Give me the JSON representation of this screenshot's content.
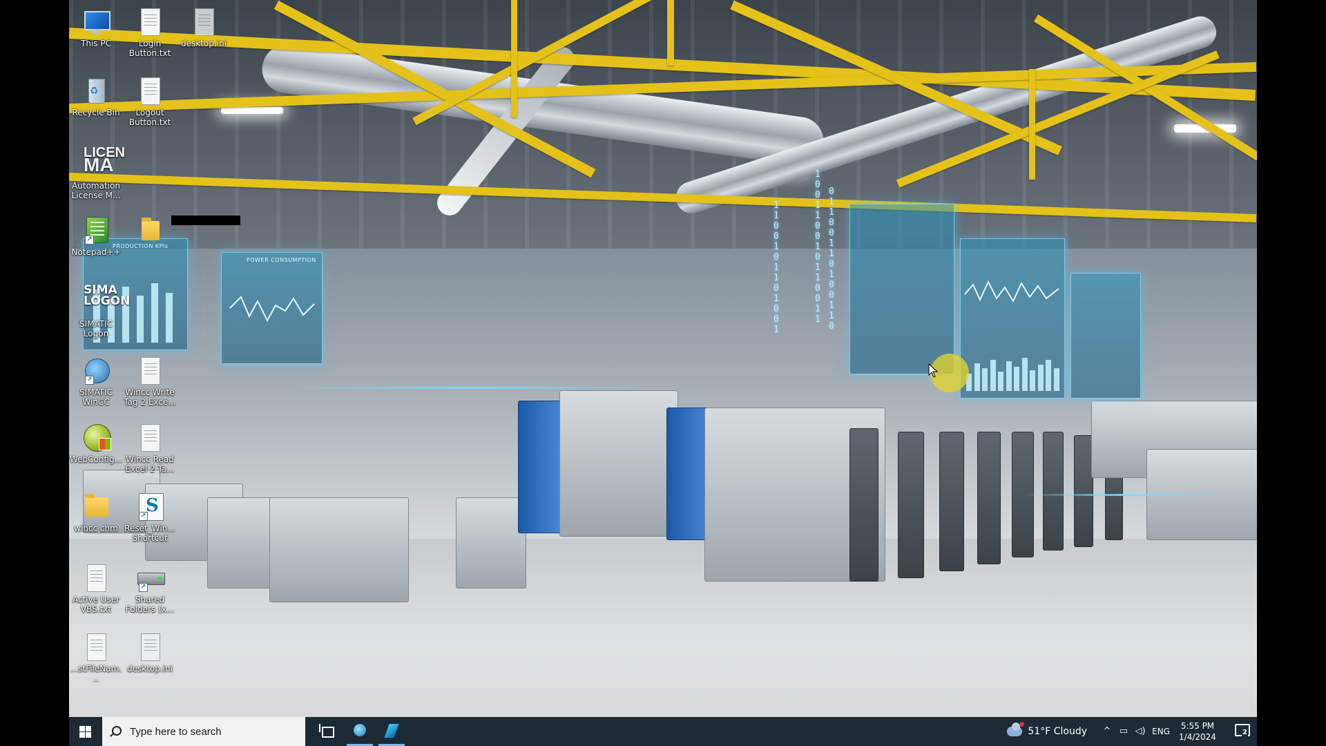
{
  "desktop": {
    "icons": [
      {
        "label": "This PC",
        "icon": "computer-icon"
      },
      {
        "label": "Login Button.txt",
        "icon": "text-file-icon"
      },
      {
        "label": "desktop.ini",
        "icon": "ini-file-icon"
      },
      {
        "label": "Recycle Bin",
        "icon": "recycle-bin-icon"
      },
      {
        "label": "Logout Button.txt",
        "icon": "text-file-icon"
      },
      {
        "label": "Automation License M...",
        "icon": "license-manager-icon"
      },
      {
        "label": "Notepad++",
        "icon": "notepad-plus-plus-icon"
      },
      {
        "label": "",
        "icon": "folder-icon"
      },
      {
        "label": "SIMATIC Logon",
        "icon": "simatic-logon-icon"
      },
      {
        "label": "SIMATIC WinCC",
        "icon": "simatic-wincc-icon"
      },
      {
        "label": "Wincc Write Tag 2 Exce...",
        "icon": "text-file-icon"
      },
      {
        "label": "WebConfig...",
        "icon": "webconfig-icon"
      },
      {
        "label": "Wincc Read Excel 2 Ta...",
        "icon": "text-file-icon"
      },
      {
        "label": "wincc chm",
        "icon": "folder-icon"
      },
      {
        "label": "Reset_Win... Shortcut",
        "icon": "script-shortcut-icon"
      },
      {
        "label": "Active User VBS.txt",
        "icon": "text-file-icon"
      },
      {
        "label": "Shared Folders (x...",
        "icon": "shared-folders-icon"
      },
      {
        "label": "...stFileNam...",
        "icon": "text-file-icon"
      },
      {
        "label": "desktop.ini",
        "icon": "ini-file-icon"
      }
    ],
    "icon_glyph_text": {
      "license": "LICEN",
      "license_sub": "MA",
      "simatic": "SIMA",
      "simatic_sub": "LOGON",
      "shortcut_arrow": "↗",
      "reset_letter": "S",
      "bin_symbol": "♻"
    }
  },
  "wallpaper": {
    "holo_titles": [
      "PRODUCTION KPIs",
      "POWER CONSUMPTION"
    ],
    "holo_kpi_bars": [
      0.85,
      0.7,
      0.9,
      0.75,
      0.95,
      0.8
    ],
    "holo_right_bars": [
      0.5,
      0.8,
      0.65,
      0.9,
      0.55,
      0.85,
      0.7,
      0.95,
      0.6,
      0.75,
      0.9,
      0.65
    ],
    "binary_col_1": "1\n0\n0\n1\n1\n0\n0\n1\n0\n1\n1\n0\n0\n1\n1",
    "binary_col_2": "0\n1\n1\n0\n0\n1\n1\n0\n1\n0\n0\n1\n1\n0",
    "binary_col_3": "1\n1\n0\n0\n1\n0\n1\n1\n0\n1\n0\n0\n1"
  },
  "taskbar": {
    "search_placeholder": "Type here to search",
    "weather_text": "51°F  Cloudy",
    "language": "ENG",
    "time": "5:55 PM",
    "date": "1/4/2024",
    "notification_count": "2",
    "tray_chevron": "^",
    "tray_network": "▭",
    "tray_volume": "◁)"
  },
  "colors": {
    "taskbar_bg": "#1c2a35",
    "accent": "#7ab8e8",
    "cursor_halo": "#e6d728"
  }
}
